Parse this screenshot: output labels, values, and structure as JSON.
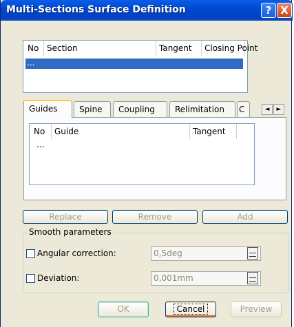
{
  "window": {
    "title": "Multi-Sections Surface Definition"
  },
  "titlebar": {
    "help": "?",
    "close": "X"
  },
  "sections": {
    "columns": [
      "No",
      "Section",
      "Tangent",
      "Closing Point"
    ],
    "rows": [
      "..."
    ]
  },
  "tabs": [
    "Guides",
    "Spine",
    "Coupling",
    "Relimitation",
    "C"
  ],
  "tab_scroll": {
    "left": "◄",
    "right": "►"
  },
  "guides": {
    "columns": [
      "No",
      "Guide",
      "Tangent"
    ],
    "rows": [
      "..."
    ]
  },
  "actions": {
    "replace": "Replace",
    "remove": "Remove",
    "add": "Add"
  },
  "smooth": {
    "title": "Smooth parameters",
    "angular_label": "Angular correction:",
    "angular_value": "0,5deg",
    "deviation_label": "Deviation:",
    "deviation_value": "0,001mm"
  },
  "buttons": {
    "ok": "OK",
    "cancel": "Cancel",
    "preview": "Preview"
  }
}
